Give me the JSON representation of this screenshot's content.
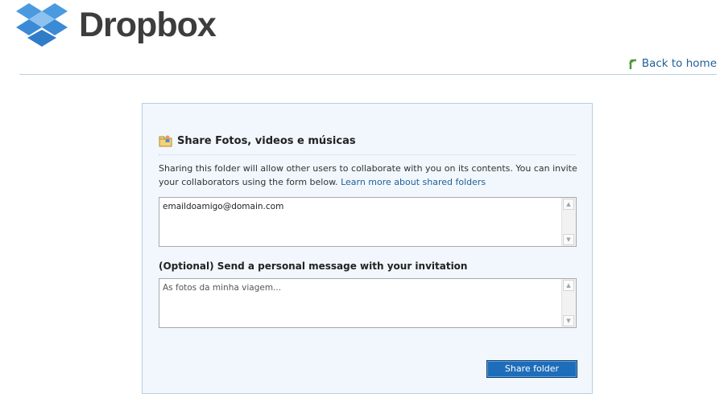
{
  "brand": {
    "name": "Dropbox"
  },
  "header": {
    "back_link": "Back to home"
  },
  "share_panel": {
    "title": "Share Fotos, videos e músicas",
    "description": "Sharing this folder will allow other users to collaborate with you on its contents. You can invite your collaborators using the form below.",
    "learn_more_link": "Learn more about shared folders",
    "emails_value": "emaildoamigo@domain.com",
    "message_label": "(Optional) Send a personal message with your invitation",
    "message_value": "As fotos da minha viagem...",
    "submit_label": "Share folder"
  },
  "colors": {
    "brand_blue": "#1e6dba",
    "link": "#1f5f9a",
    "panel_bg": "#f1f7fc"
  }
}
